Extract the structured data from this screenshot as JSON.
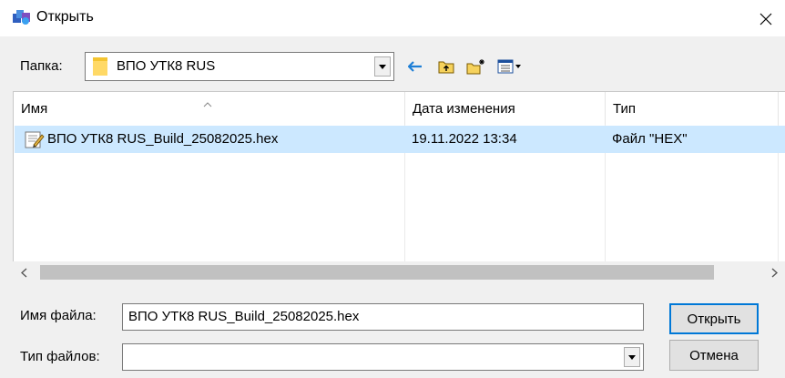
{
  "window": {
    "title": "Открыть"
  },
  "toolbar": {
    "folder_label": "Папка:",
    "folder_value": "ВПО УТК8 RUS",
    "icons": [
      "back-icon",
      "up-folder-icon",
      "new-folder-icon",
      "view-menu-icon"
    ]
  },
  "file_list": {
    "columns": [
      "Имя",
      "Дата изменения",
      "Тип"
    ],
    "rows": [
      {
        "name": "ВПО УТК8 RUS_Build_25082025.hex",
        "date": "19.11.2022 13:34",
        "type": "Файл \"HEX\""
      }
    ]
  },
  "filename": {
    "label": "Имя файла:",
    "value": "ВПО УТК8 RUS_Build_25082025.hex"
  },
  "filetype": {
    "label": "Тип файлов:",
    "value": ""
  },
  "buttons": {
    "open": "Открыть",
    "cancel": "Отмена"
  },
  "colors": {
    "selection": "#cce8ff",
    "accent": "#0078d7"
  }
}
